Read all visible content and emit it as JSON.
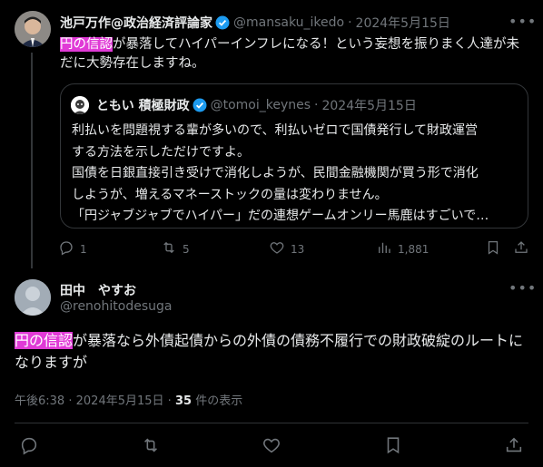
{
  "post1": {
    "name": "池戸万作@政治経済評論家",
    "handle": "@mansaku_ikedo",
    "separator": "·",
    "date": "2024年5月15日",
    "text_highlight": "円の信認",
    "text_rest": "が暴落してハイパーインフレになる！という妄想を振りまく人達が未だに大勢存在しますね。",
    "quote": {
      "name": "ともい 積極財政",
      "handle": "@tomoi_keynes",
      "separator": "·",
      "date": "2024年5月15日",
      "lines": [
        "利払いを問題視する輩が多いので、利払いゼロで国債発行して財政運営",
        "する方法を示しただけですよ。",
        "国債を日銀直接引き受けで消化しようが、民間金融機関が買う形で消化",
        "しようが、増えるマネーストックの量は変わりません。",
        "「円ジャブジャブでハイパー」だの連想ゲームオンリー馬鹿はすごいで…"
      ]
    },
    "actions": {
      "reply": "1",
      "retweet": "5",
      "like": "13",
      "views": "1,881"
    }
  },
  "post2": {
    "name": "田中　やすお",
    "handle": "@renohitodesuga",
    "text_highlight": "円の信認",
    "text_rest": "が暴落なら外債起債からの外債の債務不履行での財政破綻のルートになりますが",
    "time": "午後6:38",
    "separator": "·",
    "date": "2024年5月15日",
    "separator2": "·",
    "views_count": "35",
    "views_label": "件の表示"
  },
  "colors": {
    "background": "#000000",
    "text": "#e7e9ea",
    "muted": "#71767b",
    "verified": "#1d9bf0",
    "highlight": "#e03ad6",
    "border": "#333639"
  },
  "icons": [
    "reply-icon",
    "retweet-icon",
    "like-icon",
    "views-icon",
    "bookmark-icon",
    "share-icon",
    "verified-badge-icon",
    "more-icon"
  ]
}
